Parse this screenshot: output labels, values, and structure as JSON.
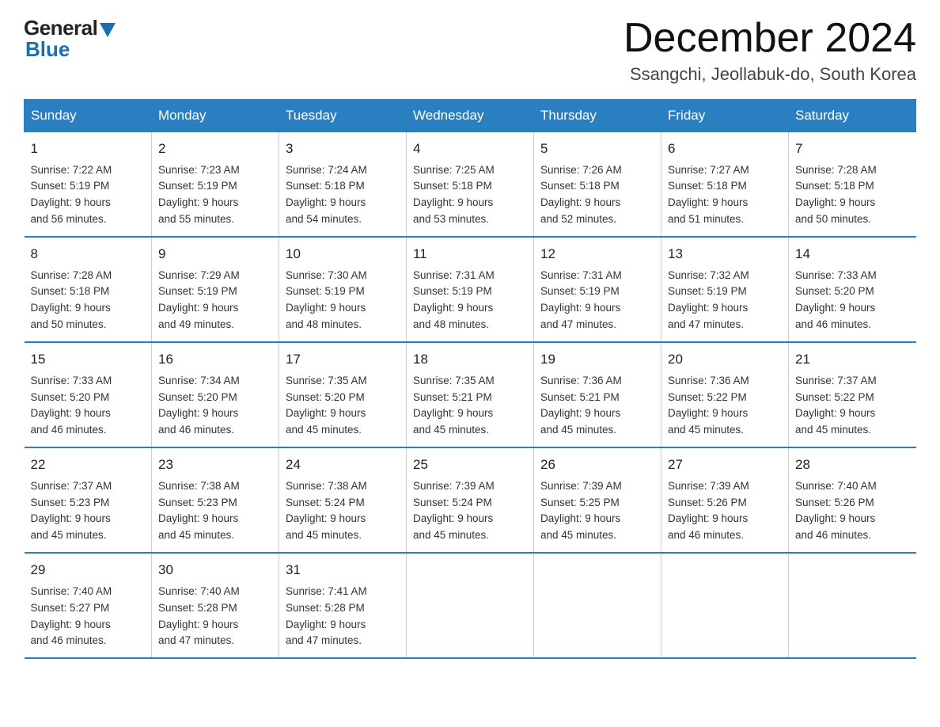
{
  "logo": {
    "general": "General",
    "blue": "Blue"
  },
  "header": {
    "month_year": "December 2024",
    "location": "Ssangchi, Jeollabuk-do, South Korea"
  },
  "days_of_week": [
    "Sunday",
    "Monday",
    "Tuesday",
    "Wednesday",
    "Thursday",
    "Friday",
    "Saturday"
  ],
  "weeks": [
    [
      {
        "day": "1",
        "sunrise": "7:22 AM",
        "sunset": "5:19 PM",
        "daylight": "9 hours and 56 minutes."
      },
      {
        "day": "2",
        "sunrise": "7:23 AM",
        "sunset": "5:19 PM",
        "daylight": "9 hours and 55 minutes."
      },
      {
        "day": "3",
        "sunrise": "7:24 AM",
        "sunset": "5:18 PM",
        "daylight": "9 hours and 54 minutes."
      },
      {
        "day": "4",
        "sunrise": "7:25 AM",
        "sunset": "5:18 PM",
        "daylight": "9 hours and 53 minutes."
      },
      {
        "day": "5",
        "sunrise": "7:26 AM",
        "sunset": "5:18 PM",
        "daylight": "9 hours and 52 minutes."
      },
      {
        "day": "6",
        "sunrise": "7:27 AM",
        "sunset": "5:18 PM",
        "daylight": "9 hours and 51 minutes."
      },
      {
        "day": "7",
        "sunrise": "7:28 AM",
        "sunset": "5:18 PM",
        "daylight": "9 hours and 50 minutes."
      }
    ],
    [
      {
        "day": "8",
        "sunrise": "7:28 AM",
        "sunset": "5:18 PM",
        "daylight": "9 hours and 50 minutes."
      },
      {
        "day": "9",
        "sunrise": "7:29 AM",
        "sunset": "5:19 PM",
        "daylight": "9 hours and 49 minutes."
      },
      {
        "day": "10",
        "sunrise": "7:30 AM",
        "sunset": "5:19 PM",
        "daylight": "9 hours and 48 minutes."
      },
      {
        "day": "11",
        "sunrise": "7:31 AM",
        "sunset": "5:19 PM",
        "daylight": "9 hours and 48 minutes."
      },
      {
        "day": "12",
        "sunrise": "7:31 AM",
        "sunset": "5:19 PM",
        "daylight": "9 hours and 47 minutes."
      },
      {
        "day": "13",
        "sunrise": "7:32 AM",
        "sunset": "5:19 PM",
        "daylight": "9 hours and 47 minutes."
      },
      {
        "day": "14",
        "sunrise": "7:33 AM",
        "sunset": "5:20 PM",
        "daylight": "9 hours and 46 minutes."
      }
    ],
    [
      {
        "day": "15",
        "sunrise": "7:33 AM",
        "sunset": "5:20 PM",
        "daylight": "9 hours and 46 minutes."
      },
      {
        "day": "16",
        "sunrise": "7:34 AM",
        "sunset": "5:20 PM",
        "daylight": "9 hours and 46 minutes."
      },
      {
        "day": "17",
        "sunrise": "7:35 AM",
        "sunset": "5:20 PM",
        "daylight": "9 hours and 45 minutes."
      },
      {
        "day": "18",
        "sunrise": "7:35 AM",
        "sunset": "5:21 PM",
        "daylight": "9 hours and 45 minutes."
      },
      {
        "day": "19",
        "sunrise": "7:36 AM",
        "sunset": "5:21 PM",
        "daylight": "9 hours and 45 minutes."
      },
      {
        "day": "20",
        "sunrise": "7:36 AM",
        "sunset": "5:22 PM",
        "daylight": "9 hours and 45 minutes."
      },
      {
        "day": "21",
        "sunrise": "7:37 AM",
        "sunset": "5:22 PM",
        "daylight": "9 hours and 45 minutes."
      }
    ],
    [
      {
        "day": "22",
        "sunrise": "7:37 AM",
        "sunset": "5:23 PM",
        "daylight": "9 hours and 45 minutes."
      },
      {
        "day": "23",
        "sunrise": "7:38 AM",
        "sunset": "5:23 PM",
        "daylight": "9 hours and 45 minutes."
      },
      {
        "day": "24",
        "sunrise": "7:38 AM",
        "sunset": "5:24 PM",
        "daylight": "9 hours and 45 minutes."
      },
      {
        "day": "25",
        "sunrise": "7:39 AM",
        "sunset": "5:24 PM",
        "daylight": "9 hours and 45 minutes."
      },
      {
        "day": "26",
        "sunrise": "7:39 AM",
        "sunset": "5:25 PM",
        "daylight": "9 hours and 45 minutes."
      },
      {
        "day": "27",
        "sunrise": "7:39 AM",
        "sunset": "5:26 PM",
        "daylight": "9 hours and 46 minutes."
      },
      {
        "day": "28",
        "sunrise": "7:40 AM",
        "sunset": "5:26 PM",
        "daylight": "9 hours and 46 minutes."
      }
    ],
    [
      {
        "day": "29",
        "sunrise": "7:40 AM",
        "sunset": "5:27 PM",
        "daylight": "9 hours and 46 minutes."
      },
      {
        "day": "30",
        "sunrise": "7:40 AM",
        "sunset": "5:28 PM",
        "daylight": "9 hours and 47 minutes."
      },
      {
        "day": "31",
        "sunrise": "7:41 AM",
        "sunset": "5:28 PM",
        "daylight": "9 hours and 47 minutes."
      },
      null,
      null,
      null,
      null
    ]
  ],
  "labels": {
    "sunrise_prefix": "Sunrise: ",
    "sunset_prefix": "Sunset: ",
    "daylight_prefix": "Daylight: "
  }
}
